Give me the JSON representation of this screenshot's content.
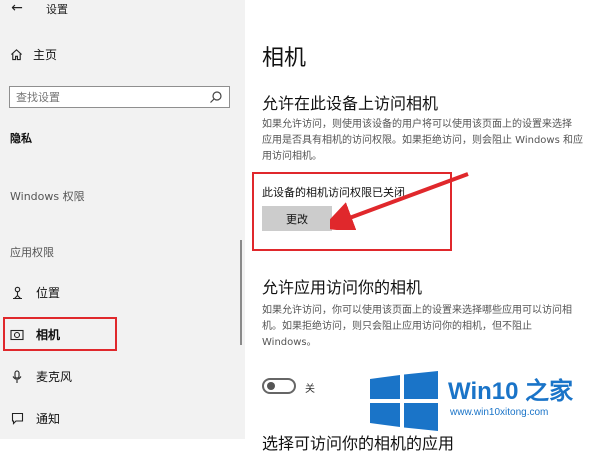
{
  "window": {
    "title": "设置"
  },
  "sidebar": {
    "home_label": "主页",
    "search_placeholder": "查找设置",
    "section_privacy": "隐私",
    "section_windows_permissions": "Windows 权限",
    "section_app_permissions": "应用权限",
    "items": [
      {
        "label": "位置",
        "icon": "location-icon"
      },
      {
        "label": "相机",
        "icon": "camera-icon",
        "selected": true
      },
      {
        "label": "麦克风",
        "icon": "microphone-icon"
      },
      {
        "label": "通知",
        "icon": "notification-icon"
      }
    ]
  },
  "main": {
    "title": "相机",
    "section1": {
      "heading": "允许在此设备上访问相机",
      "lines": [
        "如果允许访问，则使用该设备的用户将可以使用该页面上的设置来选择",
        "应用是否具有相机的访问权限。如果拒绝访问，则会阻止 Windows 和应",
        "用访问相机。"
      ],
      "status": "此设备的相机访问权限已关闭",
      "change_button": "更改"
    },
    "section2": {
      "heading": "允许应用访问你的相机",
      "lines": [
        "如果允许访问，你可以使用该页面上的设置来选择哪些应用可以访问相",
        "机。如果拒绝访问，则只会阻止应用访问你的相机，但不阻止",
        "Windows。"
      ],
      "toggle_label": "关",
      "toggle_on": false
    },
    "section3": {
      "heading": "选择可访问你的相机的应用"
    }
  },
  "annotation": {
    "color": "#e0282c"
  },
  "watermark": {
    "brand": "Win10 之家",
    "url": "www.win10xitong.com",
    "color": "#1a74c8"
  }
}
